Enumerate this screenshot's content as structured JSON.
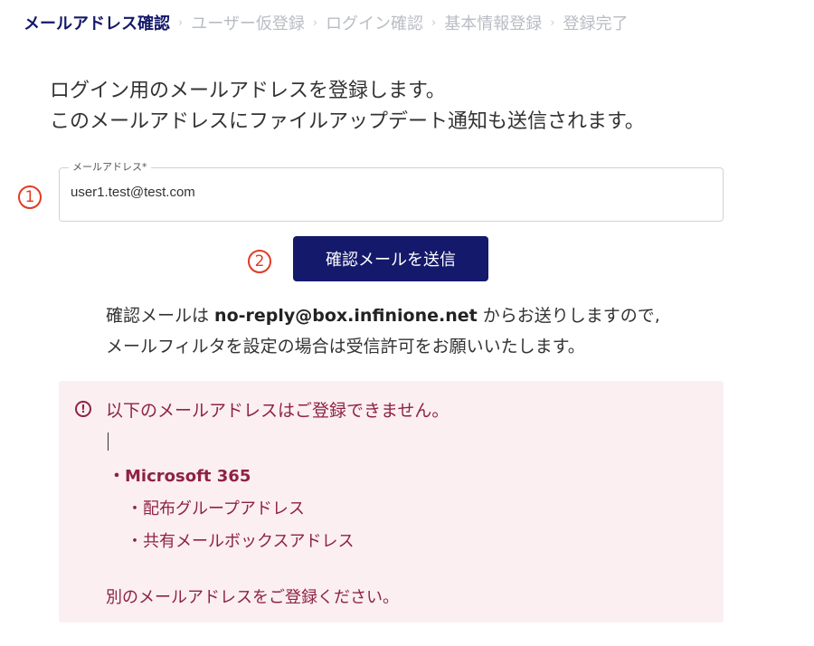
{
  "breadcrumb": {
    "steps": [
      "メールアドレス確認",
      "ユーザー仮登録",
      "ログイン確認",
      "基本情報登録",
      "登録完了"
    ],
    "separator": "›"
  },
  "intro": {
    "line1": "ログイン用のメールアドレスを登録します。",
    "line2": "このメールアドレスにファイルアップデート通知も送信されます。"
  },
  "markers": {
    "one": "1",
    "two": "2"
  },
  "email_field": {
    "label": "メールアドレス*",
    "value": "user1.test@test.com"
  },
  "send_button": {
    "label": "確認メールを送信"
  },
  "note": {
    "line1_prefix": "確認メールは ",
    "sender": "no-reply@box.infinione.net",
    "line1_suffix": " からお送りしますので,",
    "line2": "メールフィルタを設定の場合は受信許可をお願いいたします。"
  },
  "alert": {
    "title": "以下のメールアドレスはご登録できません。",
    "list_head": "・Microsoft 365",
    "items": [
      "・配布グループアドレス",
      "・共有メールボックスアドレス"
    ],
    "footer": "別のメールアドレスをご登録ください。"
  },
  "colors": {
    "primary": "#14196b",
    "marker": "#e23a22",
    "alert_bg": "#fbeff2",
    "alert_text": "#8e2246"
  }
}
